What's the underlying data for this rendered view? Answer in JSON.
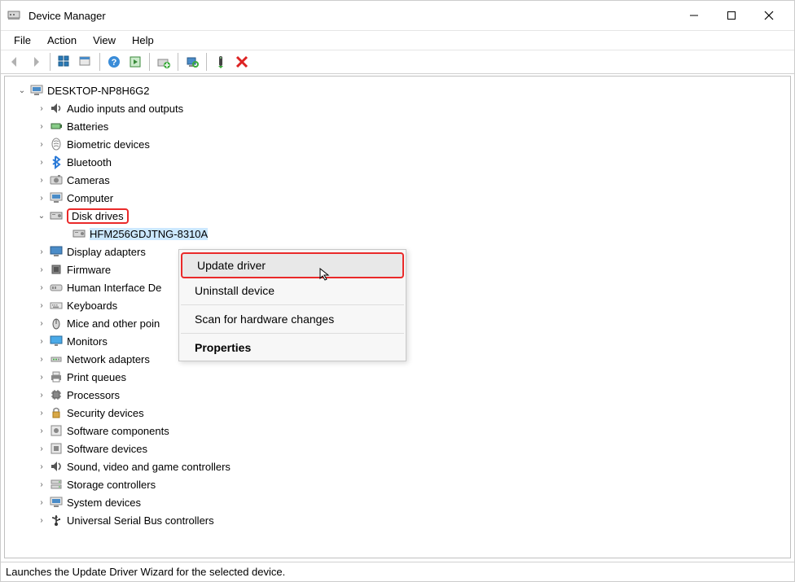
{
  "window": {
    "title": "Device Manager"
  },
  "menubar": {
    "file": "File",
    "action": "Action",
    "view": "View",
    "help": "Help"
  },
  "tree": {
    "root": "DESKTOP-NP8H6G2",
    "categories": [
      {
        "label": "Audio inputs and outputs",
        "expanded": false
      },
      {
        "label": "Batteries",
        "expanded": false
      },
      {
        "label": "Biometric devices",
        "expanded": false
      },
      {
        "label": "Bluetooth",
        "expanded": false
      },
      {
        "label": "Cameras",
        "expanded": false
      },
      {
        "label": "Computer",
        "expanded": false
      },
      {
        "label": "Disk drives",
        "expanded": true,
        "highlight": true,
        "devices": [
          {
            "label": "HFM256GDJTNG-8310A",
            "selected": true
          }
        ]
      },
      {
        "label": "Display adapters",
        "expanded": false
      },
      {
        "label": "Firmware",
        "expanded": false
      },
      {
        "label": "Human Interface Devices",
        "truncated": "Human Interface De",
        "expanded": false
      },
      {
        "label": "Keyboards",
        "expanded": false
      },
      {
        "label": "Mice and other pointing devices",
        "truncated": "Mice and other poin",
        "expanded": false
      },
      {
        "label": "Monitors",
        "expanded": false
      },
      {
        "label": "Network adapters",
        "expanded": false
      },
      {
        "label": "Print queues",
        "expanded": false
      },
      {
        "label": "Processors",
        "expanded": false
      },
      {
        "label": "Security devices",
        "expanded": false
      },
      {
        "label": "Software components",
        "expanded": false
      },
      {
        "label": "Software devices",
        "expanded": false
      },
      {
        "label": "Sound, video and game controllers",
        "expanded": false
      },
      {
        "label": "Storage controllers",
        "expanded": false
      },
      {
        "label": "System devices",
        "expanded": false
      },
      {
        "label": "Universal Serial Bus controllers",
        "expanded": false
      }
    ]
  },
  "context_menu": {
    "update": "Update driver",
    "uninstall": "Uninstall device",
    "scan": "Scan for hardware changes",
    "properties": "Properties"
  },
  "status": {
    "text": "Launches the Update Driver Wizard for the selected device."
  }
}
